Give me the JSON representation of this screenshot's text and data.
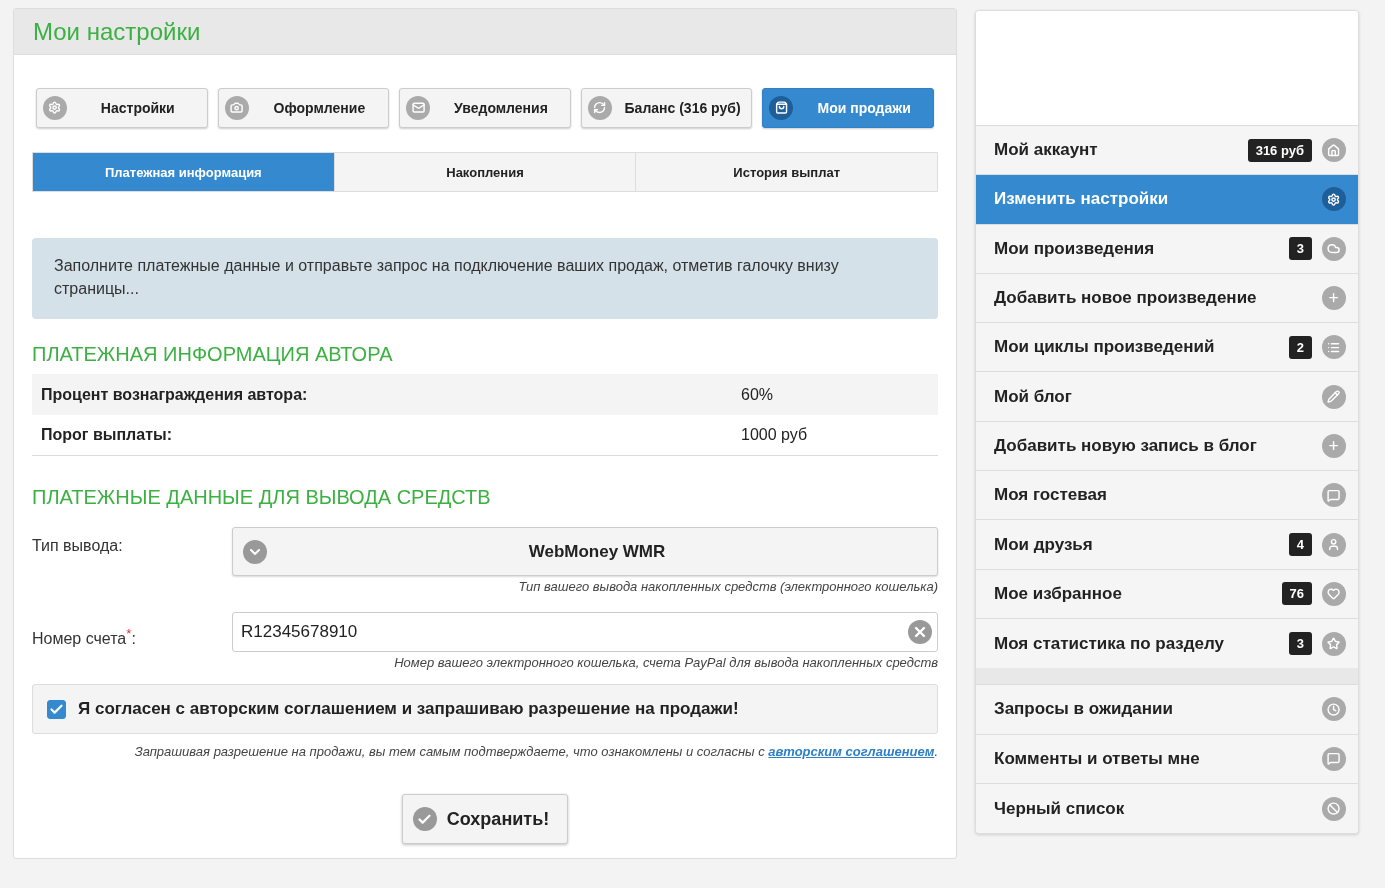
{
  "panel": {
    "title": "Мои настройки"
  },
  "nav_buttons": [
    {
      "label": "Настройки",
      "kind": "gear",
      "selected": false
    },
    {
      "label": "Оформление",
      "kind": "camera",
      "selected": false
    },
    {
      "label": "Уведомления",
      "kind": "mail",
      "selected": false
    },
    {
      "label": "Баланс (316 руб)",
      "kind": "refresh",
      "selected": false
    },
    {
      "label": "Мои продажи",
      "kind": "bag",
      "selected": true
    }
  ],
  "tabs": [
    {
      "label": "Платежная информация",
      "selected": true
    },
    {
      "label": "Накопления",
      "selected": false
    },
    {
      "label": "История выплат",
      "selected": false
    }
  ],
  "notice": "Заполните платежные данные и отправьте запрос на подключение ваших продаж, отметив галочку внизу страницы...",
  "author_section": {
    "heading": "ПЛАТЕЖНАЯ ИНФОРМАЦИЯ АВТОРА",
    "rows": [
      {
        "label": "Процент вознаграждения автора:",
        "value": "60%"
      },
      {
        "label": "Порог выплаты:",
        "value": "1000 руб"
      }
    ]
  },
  "payout_section": {
    "heading": "ПЛАТЕЖНЫЕ ДАННЫЕ ДЛЯ ВЫВОДА СРЕДСТВ",
    "type_field": {
      "label": "Тип вывода:",
      "value": "WebMoney WMR",
      "hint": "Тип вашего вывода накопленных средств (электронного кошелька)"
    },
    "account_field": {
      "label": "Номер счета",
      "required_mark": "*",
      "colon": ":",
      "value": "R12345678910",
      "hint": "Номер вашего электронного кошелька, счета PayPal для вывода накопленных средств"
    },
    "agreement": {
      "label": "Я согласен с авторским соглашением и запрашиваю разрешение на продажи!",
      "checked": true
    },
    "disclaimer": {
      "text": "Запрашивая разрешение на продажи, вы тем самым подтверждаете, что ознакомлены и согласны с ",
      "link": "авторским соглашением",
      "end": "."
    },
    "save_button": "Сохранить!"
  },
  "sidebar": {
    "groups": [
      [
        {
          "label": "Мой аккаунт",
          "badge": "316 руб",
          "kind": "home",
          "selected": false
        },
        {
          "label": "Изменить настройки",
          "kind": "gear",
          "selected": true
        },
        {
          "label": "Мои произведения",
          "badge": "3",
          "kind": "cloud",
          "selected": false
        },
        {
          "label": "Добавить новое произведение",
          "kind": "plus",
          "selected": false
        },
        {
          "label": "Мои циклы произведений",
          "badge": "2",
          "kind": "list",
          "selected": false
        },
        {
          "label": "Мой блог",
          "kind": "pencil",
          "selected": false
        },
        {
          "label": "Добавить новую запись в блог",
          "kind": "plus",
          "selected": false
        },
        {
          "label": "Моя гостевая",
          "kind": "chat",
          "selected": false
        },
        {
          "label": "Мои друзья",
          "badge": "4",
          "kind": "user",
          "selected": false
        },
        {
          "label": "Мое избранное",
          "badge": "76",
          "kind": "heart",
          "selected": false
        },
        {
          "label": "Моя статистика по разделу",
          "badge": "3",
          "kind": "star",
          "selected": false
        }
      ],
      [
        {
          "label": "Запросы в ожидании",
          "kind": "clock",
          "selected": false
        },
        {
          "label": "Комменты и ответы мне",
          "kind": "chat",
          "selected": false
        },
        {
          "label": "Черный список",
          "kind": "ban",
          "selected": false
        }
      ]
    ]
  }
}
